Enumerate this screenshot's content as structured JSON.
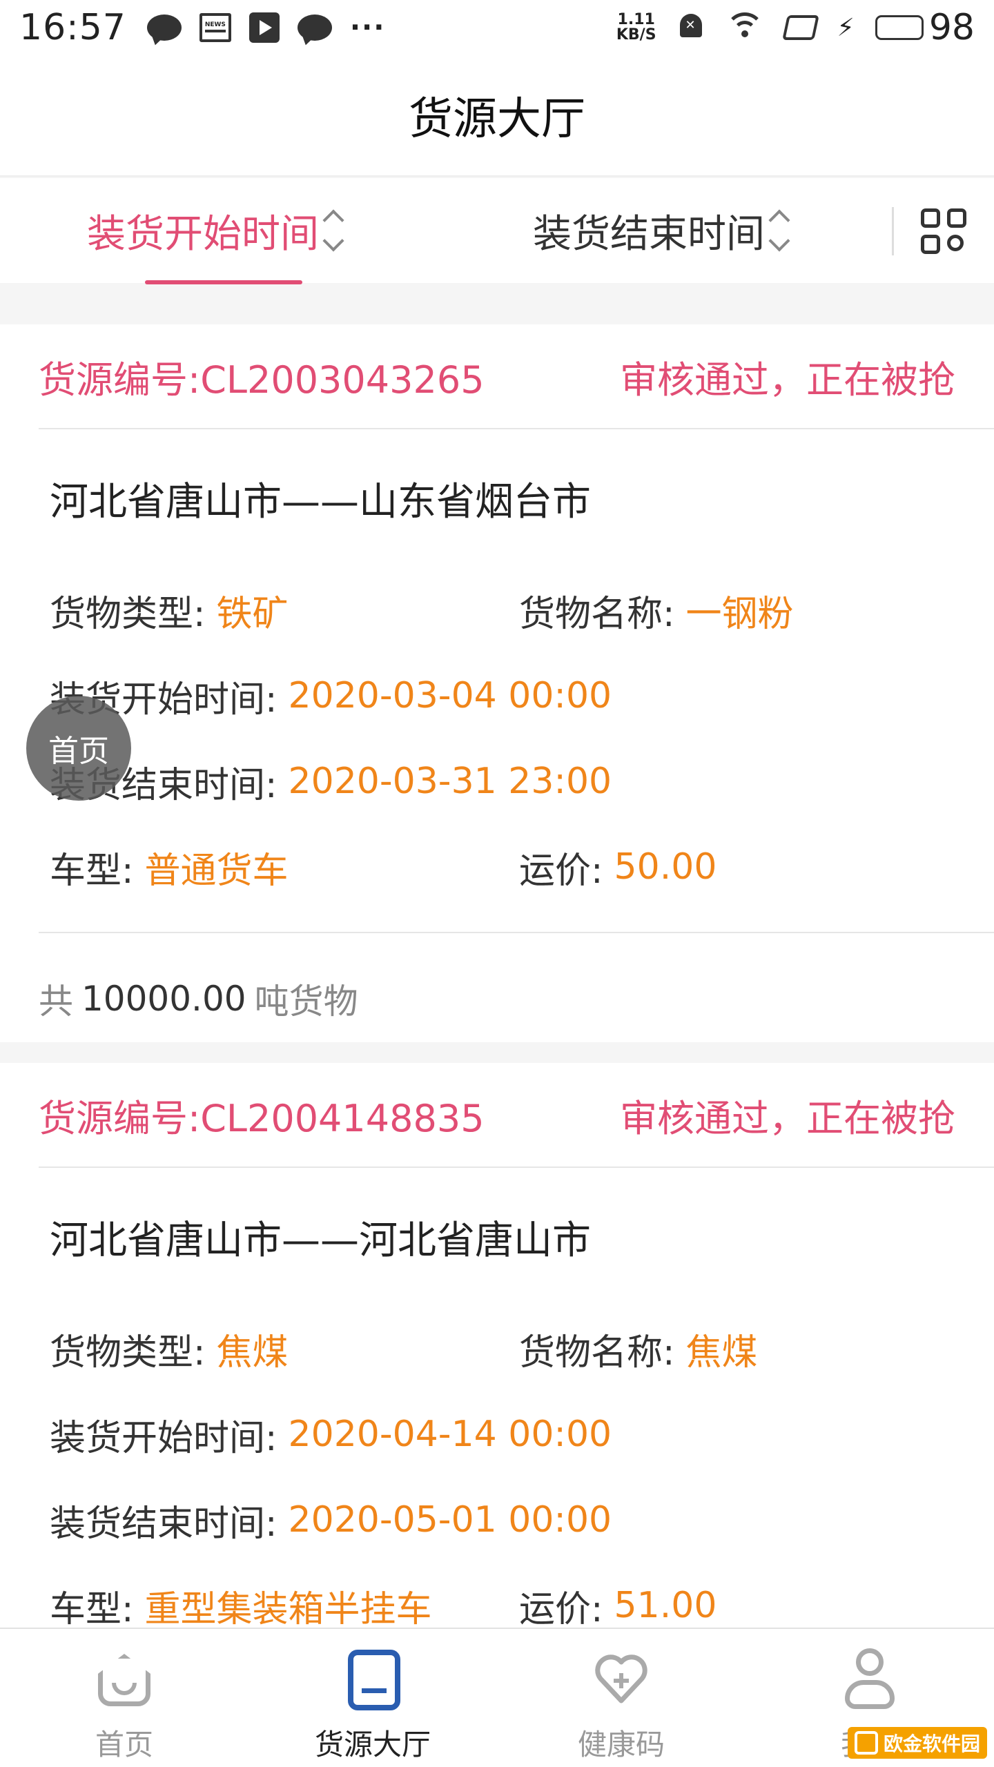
{
  "status_bar": {
    "time": "16:57",
    "net_speed_value": "1.11",
    "net_speed_unit": "KB/S",
    "news_label": "NEWS",
    "battery": "98",
    "icons": [
      "chat-icon",
      "news-icon",
      "video-icon",
      "message-icon",
      "more-icon",
      "mute-bell-icon",
      "wifi-icon",
      "rotation-icon",
      "charging-icon",
      "battery-icon"
    ]
  },
  "header": {
    "title": "货源大厅"
  },
  "sort_bar": {
    "tabs": [
      {
        "label": "装货开始时间",
        "active": true
      },
      {
        "label": "装货结束时间",
        "active": false
      }
    ],
    "accent_color": "#e14d74"
  },
  "floating_button": {
    "label": "首页"
  },
  "cards": [
    {
      "id_label": "货源编号:CL2003043265",
      "status": "审核通过，正在被抢",
      "route": "河北省唐山市——山东省烟台市",
      "cargo_type_label": "货物类型:",
      "cargo_type": "铁矿",
      "cargo_name_label": "货物名称:",
      "cargo_name": "一钢粉",
      "load_start_label": "装货开始时间:",
      "load_start": "2020-03-04 00:00",
      "load_end_label": "装货结束时间:",
      "load_end": "2020-03-31 23:00",
      "vehicle_label": "车型:",
      "vehicle": "普通货车",
      "price_label": "运价:",
      "price": "50.00",
      "total_prefix": "共",
      "total_amount": "10000.00",
      "total_suffix": "吨货物"
    },
    {
      "id_label": "货源编号:CL2004148835",
      "status": "审核通过，正在被抢",
      "route": "河北省唐山市——河北省唐山市",
      "cargo_type_label": "货物类型:",
      "cargo_type": "焦煤",
      "cargo_name_label": "货物名称:",
      "cargo_name": "焦煤",
      "load_start_label": "装货开始时间:",
      "load_start": "2020-04-14 00:00",
      "load_end_label": "装货结束时间:",
      "load_end": "2020-05-01 00:00",
      "vehicle_label": "车型:",
      "vehicle": "重型集装箱半挂车",
      "price_label": "运价:",
      "price": "51.00"
    }
  ],
  "tab_bar": {
    "items": [
      {
        "label": "首页",
        "icon": "home-icon",
        "active": false
      },
      {
        "label": "货源大厅",
        "icon": "cargo-hall-icon",
        "active": true
      },
      {
        "label": "健康码",
        "icon": "health-code-icon",
        "active": false
      },
      {
        "label": "我的",
        "icon": "profile-icon",
        "active": false
      }
    ]
  },
  "watermark": {
    "text": "欧金软件园"
  },
  "colors": {
    "accent": "#e14d74",
    "value": "#f08519",
    "tab_active": "#2a5db0"
  }
}
